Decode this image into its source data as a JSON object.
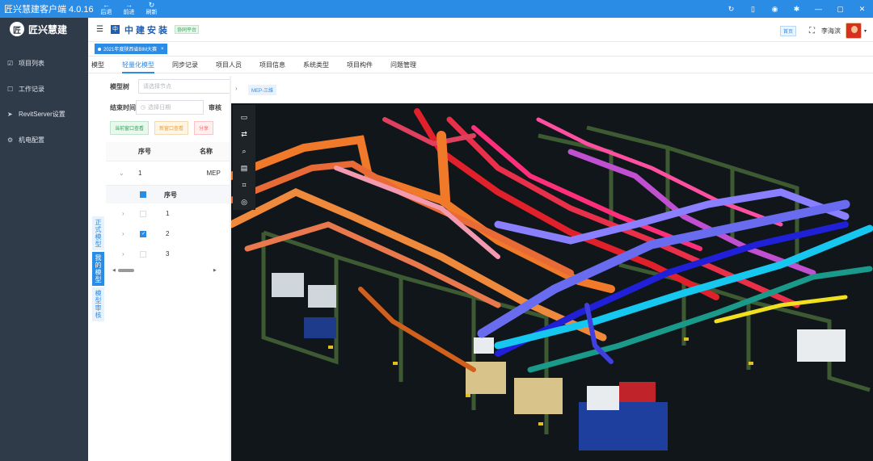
{
  "titlebar": {
    "title": "匠兴慧建客户端 4.0.16",
    "nav": [
      {
        "icon": "←",
        "label": "后退"
      },
      {
        "icon": "→",
        "label": "前进"
      },
      {
        "icon": "↻",
        "label": "刷新"
      }
    ],
    "right_icons": [
      "↻",
      "▯",
      "◉",
      "✱",
      "—",
      "▢",
      "✕"
    ]
  },
  "sidebar": {
    "logo_text": "匠兴慧建",
    "items": [
      {
        "icon": "☑",
        "label": "项目列表"
      },
      {
        "icon": "☐",
        "label": "工作记录"
      },
      {
        "icon": "➤",
        "label": "RevitServer设置"
      },
      {
        "icon": "⚙",
        "label": "机电配置"
      }
    ]
  },
  "header": {
    "brand_mark": "中",
    "brand_name": "中建安装",
    "brand_tag": "协同平台",
    "home_label": "首页",
    "user_name": "李海滨"
  },
  "project_tab": {
    "label": "2021年度陕西省BIM大赛",
    "close": "×"
  },
  "menu": [
    {
      "label": "模型",
      "active": false
    },
    {
      "label": "轻量化模型",
      "active": true
    },
    {
      "label": "同步记录",
      "active": false
    },
    {
      "label": "项目人员",
      "active": false
    },
    {
      "label": "项目信息",
      "active": false
    },
    {
      "label": "系统类型",
      "active": false
    },
    {
      "label": "项目构件",
      "active": false
    },
    {
      "label": "问题管理",
      "active": false
    }
  ],
  "vertical_tabs": [
    {
      "label": "正式模型",
      "active": false
    },
    {
      "label": "我的模型",
      "active": true
    },
    {
      "label": "模型审核",
      "active": false
    }
  ],
  "filters": {
    "tree_label": "模型树",
    "tree_placeholder": "请选择节点",
    "end_label": "结束时间",
    "end_placeholder": "选择日期",
    "audit_label": "审核"
  },
  "actions": {
    "current_window": "当前窗口查看",
    "new_window": "新窗口查看",
    "split": "分享"
  },
  "table": {
    "headers": [
      "序号",
      "名称"
    ],
    "row": {
      "index": "1",
      "name": "MEP"
    },
    "sub_header": "序号",
    "sub_rows": [
      {
        "index": "1",
        "checked": false
      },
      {
        "index": "2",
        "checked": true
      },
      {
        "index": "3",
        "checked": false
      }
    ]
  },
  "viewer": {
    "view_tag": "MEP-三维",
    "tools": [
      "monitor-icon",
      "swap-icon",
      "zoom-icon",
      "clipboard-icon",
      "crop-icon",
      "hide-icon"
    ]
  }
}
